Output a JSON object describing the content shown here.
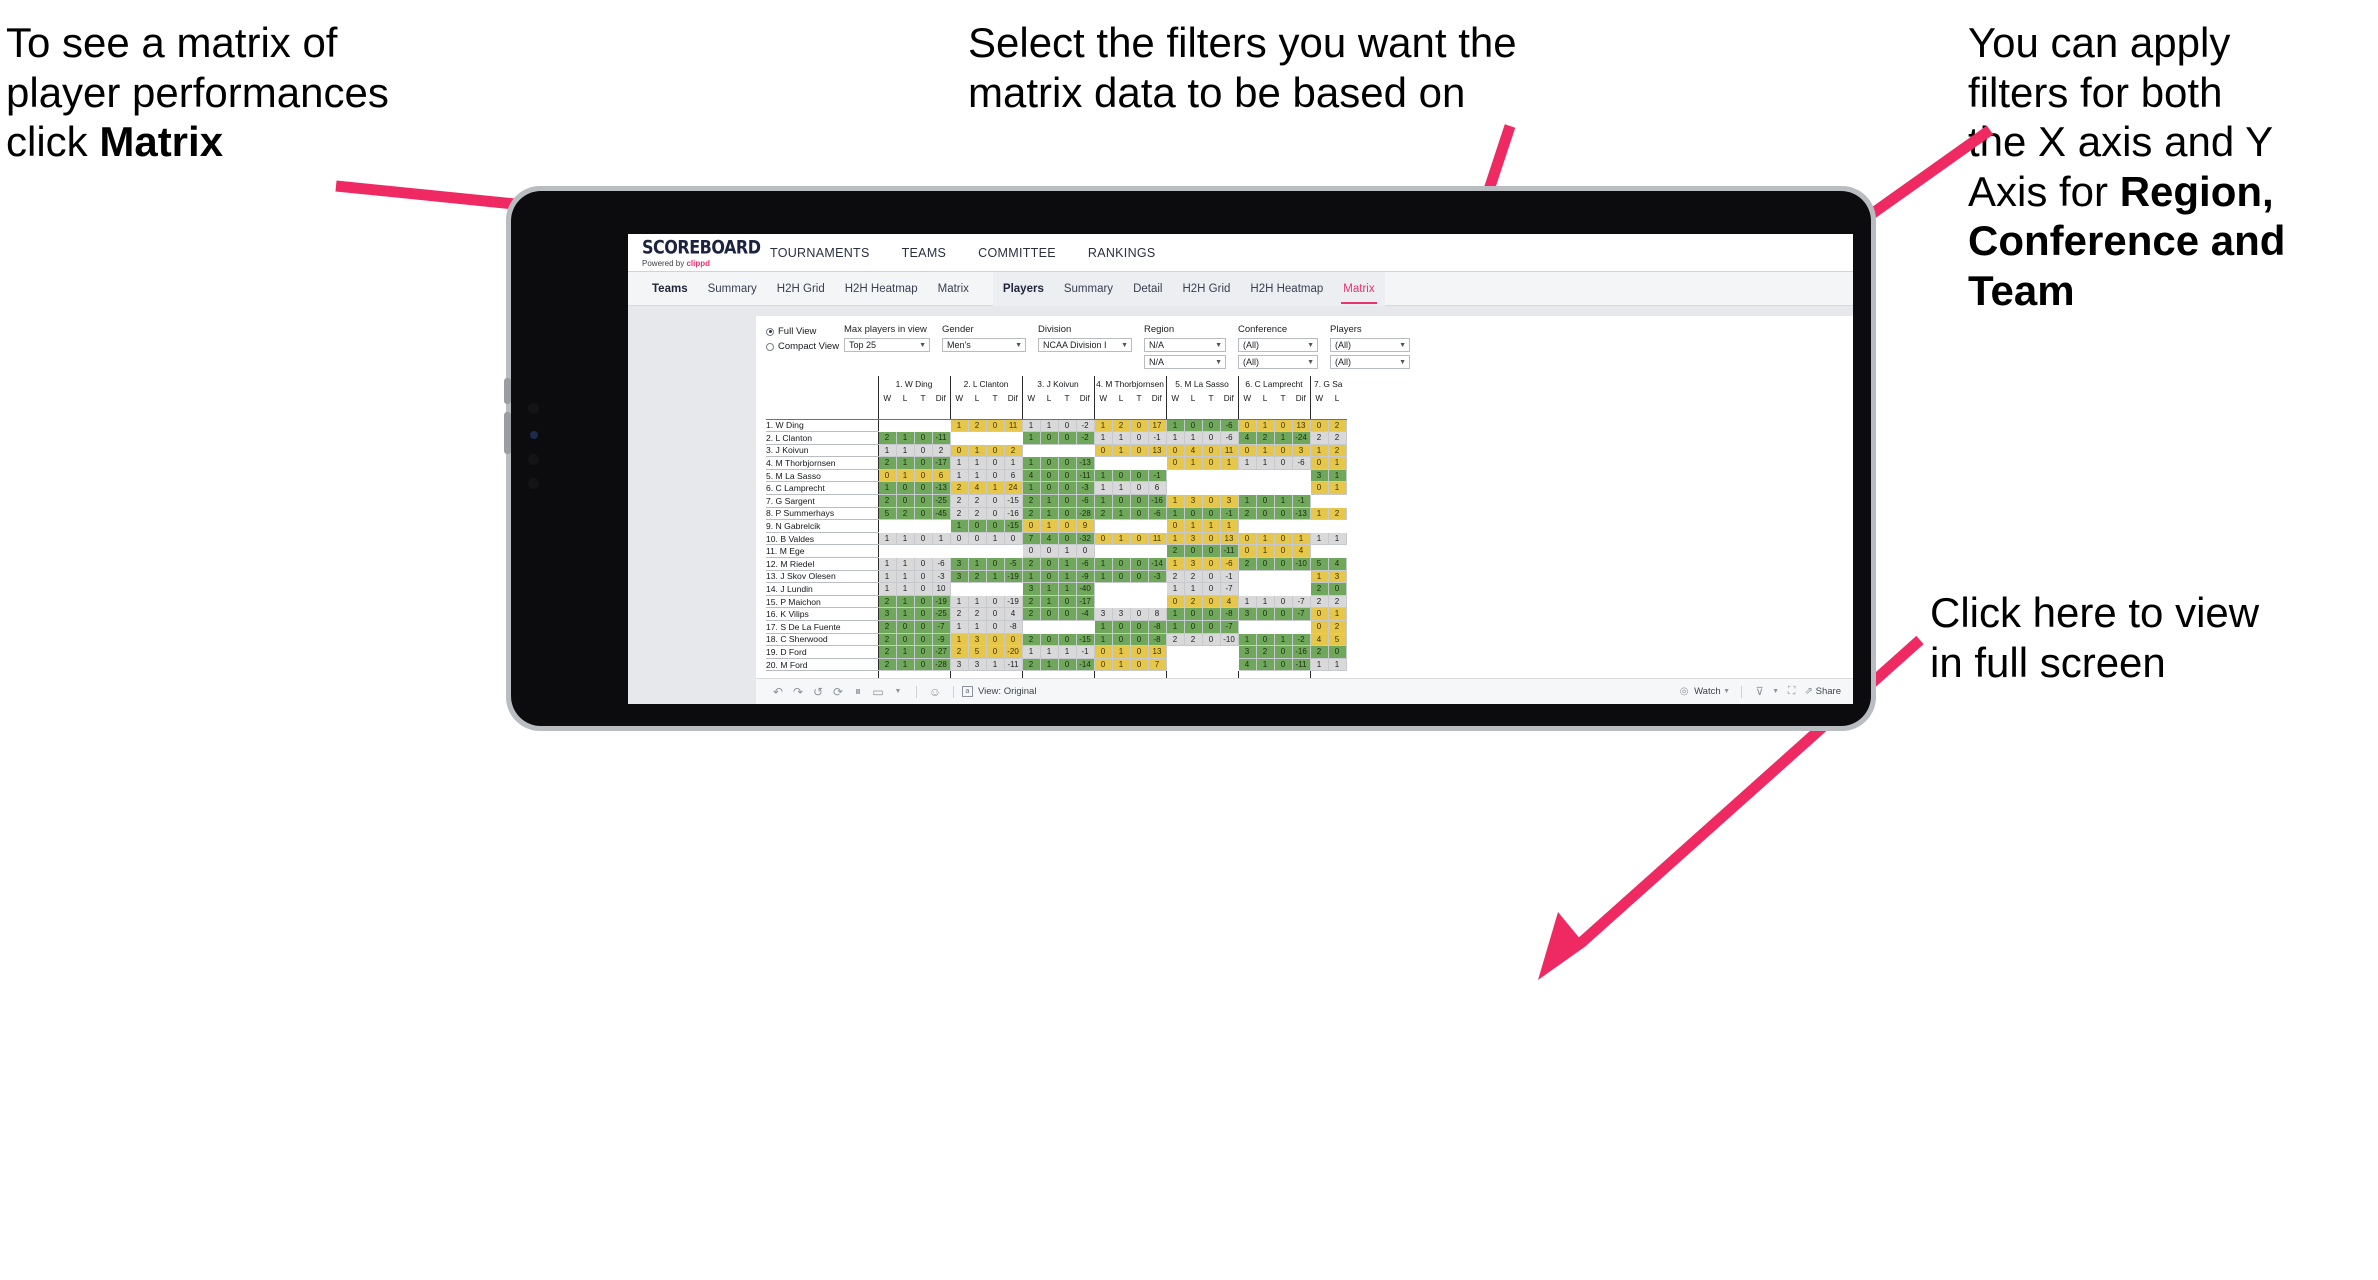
{
  "annotations": {
    "top_left": {
      "pre": "To see a matrix of\nplayer performances\nclick ",
      "bold": "Matrix",
      "post": ""
    },
    "top_center": {
      "text": "Select the filters you want the\nmatrix data to be based on"
    },
    "top_right": {
      "pre": "You  can apply\nfilters for both\nthe X axis and Y\nAxis for ",
      "bold": "Region,\nConference and\nTeam",
      "post": ""
    },
    "bottom_right": {
      "text": "Click here to view\nin full screen"
    },
    "arrow_color": "#ef2a63"
  },
  "app": {
    "brand": {
      "logo": "SCOREBOARD",
      "powered_prefix": "Powered by ",
      "powered_brand": "clippd"
    },
    "topnav": [
      "TOURNAMENTS",
      "TEAMS",
      "COMMITTEE",
      "RANKINGS"
    ],
    "subnav": {
      "teams_group": {
        "title": "Teams",
        "items": [
          "Summary",
          "H2H Grid",
          "H2H Heatmap",
          "Matrix"
        ]
      },
      "players_group": {
        "title": "Players",
        "items": [
          "Summary",
          "Detail",
          "H2H Grid",
          "H2H Heatmap",
          "Matrix"
        ],
        "active": "Matrix"
      }
    },
    "filters": {
      "view_options": [
        {
          "label": "Full View",
          "selected": true
        },
        {
          "label": "Compact View",
          "selected": false
        }
      ],
      "selects": [
        {
          "label": "Max players in view",
          "rows": [
            "Top 25"
          ],
          "width": "w-top25"
        },
        {
          "label": "Gender",
          "rows": [
            "Men's"
          ],
          "width": "w-gender"
        },
        {
          "label": "Division",
          "rows": [
            "NCAA Division I"
          ],
          "width": "w-div"
        },
        {
          "label": "Region",
          "rows": [
            "N/A",
            "N/A"
          ],
          "width": "w-reg"
        },
        {
          "label": "Conference",
          "rows": [
            "(All)",
            "(All)"
          ],
          "width": "w-conf"
        },
        {
          "label": "Players",
          "rows": [
            "(All)",
            "(All)"
          ],
          "width": "w-play"
        }
      ]
    },
    "bottom_toolbar": {
      "icons": [
        "undo-icon",
        "redo-icon",
        "revert-icon",
        "refresh-data-icon",
        "pause-updates-icon",
        "presentation-mode-icon"
      ],
      "help_icon": "help-icon",
      "view_label": "View: Original",
      "watch_label": "Watch",
      "share_label": "Share",
      "device_icon": "device-layout-icon",
      "fullscreen_icon": "fullscreen-icon"
    },
    "scrollbar": {
      "orientation": "horizontal"
    }
  },
  "chart_data": {
    "type": "table",
    "title": "Player head-to-head matrix",
    "sub_headers": [
      "W",
      "L",
      "T",
      "Dif"
    ],
    "column_groups": [
      "1. W Ding",
      "2. L Clanton",
      "3. J Koivun",
      "4. M Thorbjornsen",
      "5. M La Sasso",
      "6. C Lamprecht",
      "7. G Sa"
    ],
    "last_group_partial_subheaders": [
      "W",
      "L"
    ],
    "row_labels": [
      "1. W Ding",
      "2. L Clanton",
      "3. J Koivun",
      "4. M Thorbjornsen",
      "5. M La Sasso",
      "6. C Lamprecht",
      "7. G Sargent",
      "8. P Summerhays",
      "9. N Gabrelcik",
      "10. B Valdes",
      "11. M Ege",
      "12. M Riedel",
      "13. J Skov Olesen",
      "14. J Lundin",
      "15. P Maichon",
      "16. K Vilips",
      "17. S De La Fuente",
      "18. C Sherwood",
      "19. D Ford",
      "20. M Ford"
    ],
    "color_legend": {
      "green": "#6fa85a",
      "yellow": "#e6c74a",
      "neutral": "#d9d9d9",
      "empty": "#ffffff"
    },
    "cells": [
      [
        [
          "e",
          "",
          "",
          "",
          ""
        ],
        [
          "y",
          "1",
          "2",
          "0",
          "11"
        ],
        [
          "n",
          "1",
          "1",
          "0",
          "-2"
        ],
        [
          "y",
          "1",
          "2",
          "0",
          "17"
        ],
        [
          "g",
          "1",
          "0",
          "0",
          "-6"
        ],
        [
          "y",
          "0",
          "1",
          "0",
          "13"
        ],
        [
          "y",
          "0",
          "2"
        ]
      ],
      [
        [
          "g",
          "2",
          "1",
          "0",
          "-11"
        ],
        [
          "e",
          "",
          "",
          "",
          ""
        ],
        [
          "g",
          "1",
          "0",
          "0",
          "-2"
        ],
        [
          "n",
          "1",
          "1",
          "0",
          "-1"
        ],
        [
          "n",
          "1",
          "1",
          "0",
          "-6"
        ],
        [
          "g",
          "4",
          "2",
          "1",
          "-24"
        ],
        [
          "n",
          "2",
          "2"
        ]
      ],
      [
        [
          "n",
          "1",
          "1",
          "0",
          "2"
        ],
        [
          "y",
          "0",
          "1",
          "0",
          "2"
        ],
        [
          "e",
          "",
          "",
          "",
          ""
        ],
        [
          "y",
          "0",
          "1",
          "0",
          "13"
        ],
        [
          "y",
          "0",
          "4",
          "0",
          "11"
        ],
        [
          "y",
          "0",
          "1",
          "0",
          "3"
        ],
        [
          "y",
          "1",
          "2"
        ]
      ],
      [
        [
          "g",
          "2",
          "1",
          "0",
          "-17"
        ],
        [
          "n",
          "1",
          "1",
          "0",
          "1"
        ],
        [
          "g",
          "1",
          "0",
          "0",
          "-13"
        ],
        [
          "e",
          "",
          "",
          "",
          ""
        ],
        [
          "y",
          "0",
          "1",
          "0",
          "1"
        ],
        [
          "n",
          "1",
          "1",
          "0",
          "-6"
        ],
        [
          "y",
          "0",
          "1"
        ]
      ],
      [
        [
          "y",
          "0",
          "1",
          "0",
          "6"
        ],
        [
          "n",
          "1",
          "1",
          "0",
          "6"
        ],
        [
          "g",
          "4",
          "0",
          "0",
          "-11"
        ],
        [
          "g",
          "1",
          "0",
          "0",
          "-1"
        ],
        [
          "e",
          "",
          "",
          "",
          ""
        ],
        [
          "e",
          "",
          "",
          "",
          ""
        ],
        [
          "g",
          "3",
          "1"
        ]
      ],
      [
        [
          "g",
          "1",
          "0",
          "0",
          "-13"
        ],
        [
          "y",
          "2",
          "4",
          "1",
          "24"
        ],
        [
          "g",
          "1",
          "0",
          "0",
          "-3"
        ],
        [
          "n",
          "1",
          "1",
          "0",
          "6"
        ],
        [
          "e",
          "",
          "",
          "",
          ""
        ],
        [
          "e",
          "",
          "",
          "",
          ""
        ],
        [
          "y",
          "0",
          "1"
        ]
      ],
      [
        [
          "g",
          "2",
          "0",
          "0",
          "-25"
        ],
        [
          "n",
          "2",
          "2",
          "0",
          "-15"
        ],
        [
          "g",
          "2",
          "1",
          "0",
          "-6"
        ],
        [
          "g",
          "1",
          "0",
          "0",
          "-16"
        ],
        [
          "y",
          "1",
          "3",
          "0",
          "3"
        ],
        [
          "g",
          "1",
          "0",
          "1",
          "-1"
        ],
        [
          "e",
          "",
          ""
        ]
      ],
      [
        [
          "g",
          "5",
          "2",
          "0",
          "-45"
        ],
        [
          "n",
          "2",
          "2",
          "0",
          "-16"
        ],
        [
          "g",
          "2",
          "1",
          "0",
          "-28"
        ],
        [
          "g",
          "2",
          "1",
          "0",
          "-6"
        ],
        [
          "g",
          "1",
          "0",
          "0",
          "-1"
        ],
        [
          "g",
          "2",
          "0",
          "0",
          "-13"
        ],
        [
          "y",
          "1",
          "2"
        ]
      ],
      [
        [
          "e",
          "",
          "",
          "",
          ""
        ],
        [
          "g",
          "1",
          "0",
          "0",
          "-15"
        ],
        [
          "y",
          "0",
          "1",
          "0",
          "9"
        ],
        [
          "e",
          "",
          "",
          "",
          ""
        ],
        [
          "y",
          "0",
          "1",
          "1",
          "1"
        ],
        [
          "e",
          "",
          "",
          "",
          ""
        ],
        [
          "e",
          "",
          ""
        ]
      ],
      [
        [
          "n",
          "1",
          "1",
          "0",
          "1"
        ],
        [
          "n",
          "0",
          "0",
          "1",
          "0"
        ],
        [
          "g",
          "7",
          "4",
          "0",
          "-32"
        ],
        [
          "y",
          "0",
          "1",
          "0",
          "11"
        ],
        [
          "y",
          "1",
          "3",
          "0",
          "13"
        ],
        [
          "y",
          "0",
          "1",
          "0",
          "1"
        ],
        [
          "n",
          "1",
          "1"
        ]
      ],
      [
        [
          "e",
          "",
          "",
          "",
          ""
        ],
        [
          "e",
          "",
          "",
          "",
          ""
        ],
        [
          "n",
          "0",
          "0",
          "1",
          "0"
        ],
        [
          "e",
          "",
          "",
          "",
          ""
        ],
        [
          "g",
          "2",
          "0",
          "0",
          "-11"
        ],
        [
          "y",
          "0",
          "1",
          "0",
          "4"
        ],
        [
          "e",
          "",
          ""
        ]
      ],
      [
        [
          "n",
          "1",
          "1",
          "0",
          "-6"
        ],
        [
          "g",
          "3",
          "1",
          "0",
          "-5"
        ],
        [
          "g",
          "2",
          "0",
          "1",
          "-6"
        ],
        [
          "g",
          "1",
          "0",
          "0",
          "-14"
        ],
        [
          "y",
          "1",
          "3",
          "0",
          "-6"
        ],
        [
          "g",
          "2",
          "0",
          "0",
          "-10"
        ],
        [
          "g",
          "5",
          "4"
        ]
      ],
      [
        [
          "n",
          "1",
          "1",
          "0",
          "-3"
        ],
        [
          "g",
          "3",
          "2",
          "1",
          "-19"
        ],
        [
          "g",
          "1",
          "0",
          "1",
          "-9"
        ],
        [
          "g",
          "1",
          "0",
          "0",
          "-3"
        ],
        [
          "n",
          "2",
          "2",
          "0",
          "-1"
        ],
        [
          "e",
          "",
          "",
          "",
          ""
        ],
        [
          "y",
          "1",
          "3"
        ]
      ],
      [
        [
          "n",
          "1",
          "1",
          "0",
          "10"
        ],
        [
          "e",
          "",
          "",
          "",
          ""
        ],
        [
          "g",
          "3",
          "1",
          "1",
          "-40"
        ],
        [
          "e",
          "",
          "",
          "",
          ""
        ],
        [
          "n",
          "1",
          "1",
          "0",
          "-7"
        ],
        [
          "e",
          "",
          "",
          "",
          ""
        ],
        [
          "g",
          "2",
          "0"
        ]
      ],
      [
        [
          "g",
          "2",
          "1",
          "0",
          "-19"
        ],
        [
          "n",
          "1",
          "1",
          "0",
          "-19"
        ],
        [
          "g",
          "2",
          "1",
          "0",
          "-17"
        ],
        [
          "e",
          "",
          "",
          "",
          ""
        ],
        [
          "y",
          "0",
          "2",
          "0",
          "4"
        ],
        [
          "n",
          "1",
          "1",
          "0",
          "-7"
        ],
        [
          "n",
          "2",
          "2"
        ]
      ],
      [
        [
          "g",
          "3",
          "1",
          "0",
          "-25"
        ],
        [
          "n",
          "2",
          "2",
          "0",
          "4"
        ],
        [
          "g",
          "2",
          "0",
          "0",
          "-4"
        ],
        [
          "n",
          "3",
          "3",
          "0",
          "8"
        ],
        [
          "g",
          "1",
          "0",
          "0",
          "-8"
        ],
        [
          "g",
          "3",
          "0",
          "0",
          "-7"
        ],
        [
          "y",
          "0",
          "1"
        ]
      ],
      [
        [
          "g",
          "2",
          "0",
          "0",
          "-7"
        ],
        [
          "n",
          "1",
          "1",
          "0",
          "-8"
        ],
        [
          "e",
          "",
          "",
          "",
          ""
        ],
        [
          "g",
          "1",
          "0",
          "0",
          "-8"
        ],
        [
          "g",
          "1",
          "0",
          "0",
          "-7"
        ],
        [
          "e",
          "",
          "",
          "",
          ""
        ],
        [
          "y",
          "0",
          "2"
        ]
      ],
      [
        [
          "g",
          "2",
          "0",
          "0",
          "-9"
        ],
        [
          "y",
          "1",
          "3",
          "0",
          "0"
        ],
        [
          "g",
          "2",
          "0",
          "0",
          "-15"
        ],
        [
          "g",
          "1",
          "0",
          "0",
          "-8"
        ],
        [
          "n",
          "2",
          "2",
          "0",
          "-10"
        ],
        [
          "g",
          "1",
          "0",
          "1",
          "-2"
        ],
        [
          "y",
          "4",
          "5"
        ]
      ],
      [
        [
          "g",
          "2",
          "1",
          "0",
          "-27"
        ],
        [
          "y",
          "2",
          "5",
          "0",
          "-20"
        ],
        [
          "n",
          "1",
          "1",
          "1",
          "-1"
        ],
        [
          "y",
          "0",
          "1",
          "0",
          "13"
        ],
        [
          "e",
          "",
          "",
          "",
          ""
        ],
        [
          "g",
          "3",
          "2",
          "0",
          "-16"
        ],
        [
          "g",
          "2",
          "0"
        ]
      ],
      [
        [
          "g",
          "2",
          "1",
          "0",
          "-28"
        ],
        [
          "n",
          "3",
          "3",
          "1",
          "-11"
        ],
        [
          "g",
          "2",
          "1",
          "0",
          "-14"
        ],
        [
          "y",
          "0",
          "1",
          "0",
          "7"
        ],
        [
          "e",
          "",
          "",
          "",
          ""
        ],
        [
          "g",
          "4",
          "1",
          "0",
          "-11"
        ],
        [
          "n",
          "1",
          "1"
        ]
      ]
    ]
  }
}
